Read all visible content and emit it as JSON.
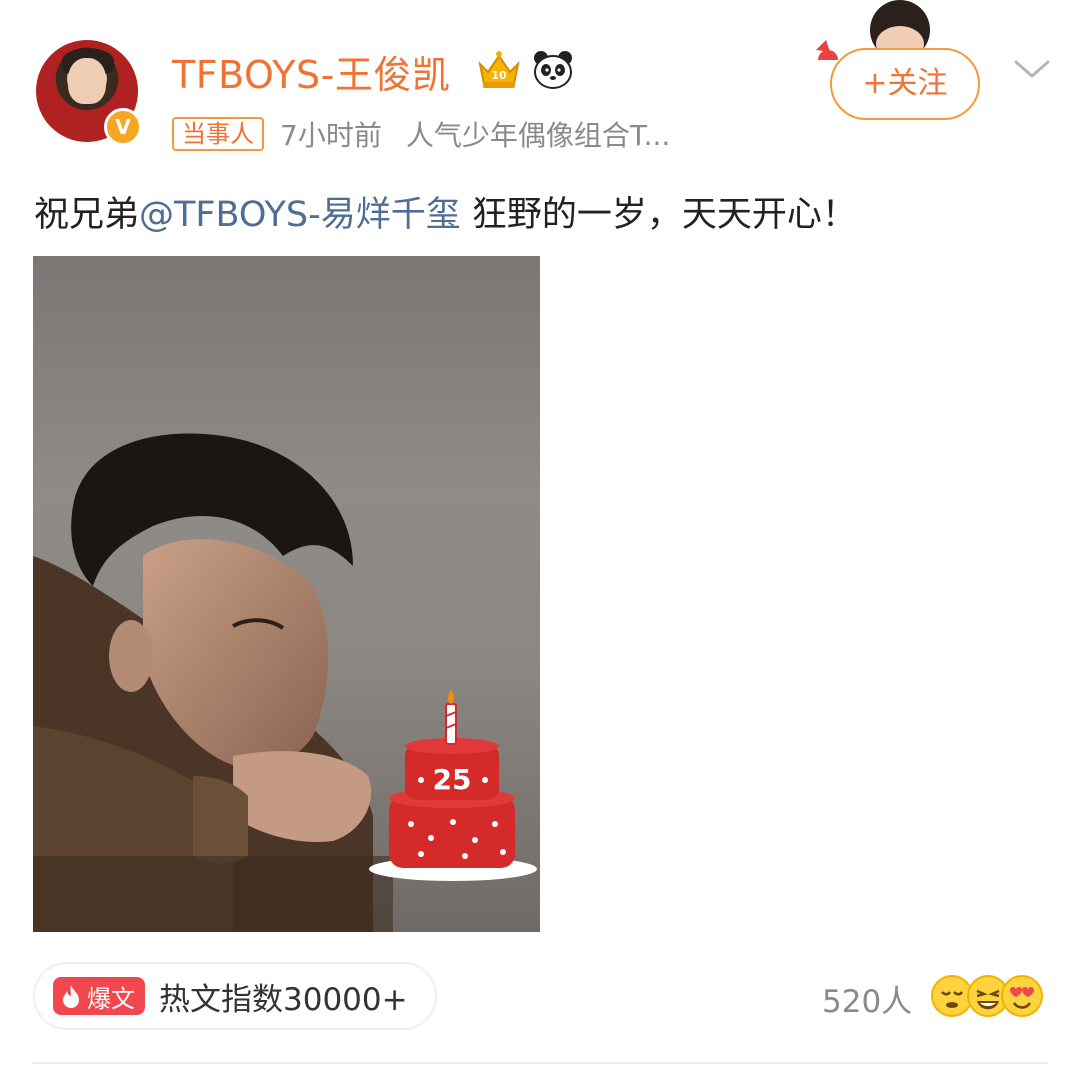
{
  "post": {
    "username": "TFBOYS-王俊凯",
    "tag": "当事人",
    "time": "7小时前",
    "description": "人气少年偶像组合T...",
    "follow_label": "+关注",
    "verified_badge": "V",
    "text_prefix": "祝兄弟",
    "mention": "@TFBOYS-易烊千玺",
    "text_suffix": " 狂野的一岁，天天开心！"
  },
  "image": {
    "cake_number": "25"
  },
  "footer": {
    "hot_badge_label": "爆文",
    "hot_index_text": "热文指数30000+",
    "likes_count": "520人"
  },
  "colors": {
    "accent": "#f17233",
    "mention": "#4f6d95",
    "hot_badge": "#f0484e"
  },
  "icons": [
    "crown-icon",
    "panda-icon",
    "chevron-down-icon",
    "fire-icon",
    "emoji-icons"
  ]
}
